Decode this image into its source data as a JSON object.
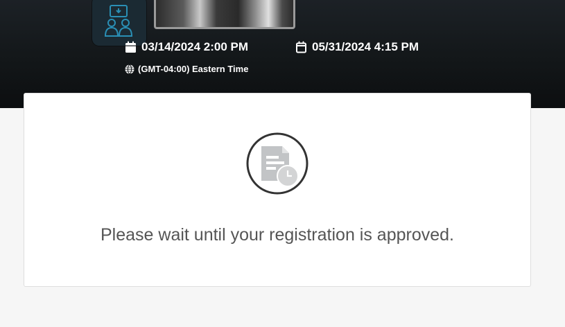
{
  "event": {
    "start_datetime": "03/14/2024 2:00 PM",
    "end_datetime": "05/31/2024 4:15 PM",
    "timezone": "(GMT-04:00) Eastern Time",
    "icons": {
      "start": "calendar-icon",
      "end": "calendar-outline-icon",
      "timezone": "globe-icon",
      "thumbnail": "presenter-icon"
    }
  },
  "registration": {
    "status_icon": "pending-document-clock-icon",
    "message": "Please wait until your registration is approved."
  },
  "colors": {
    "banner": "#131719",
    "page_background": "#f6f6f6",
    "card": "#ffffff",
    "message_text": "#555555",
    "tile_accent": "#2a8fb5"
  }
}
